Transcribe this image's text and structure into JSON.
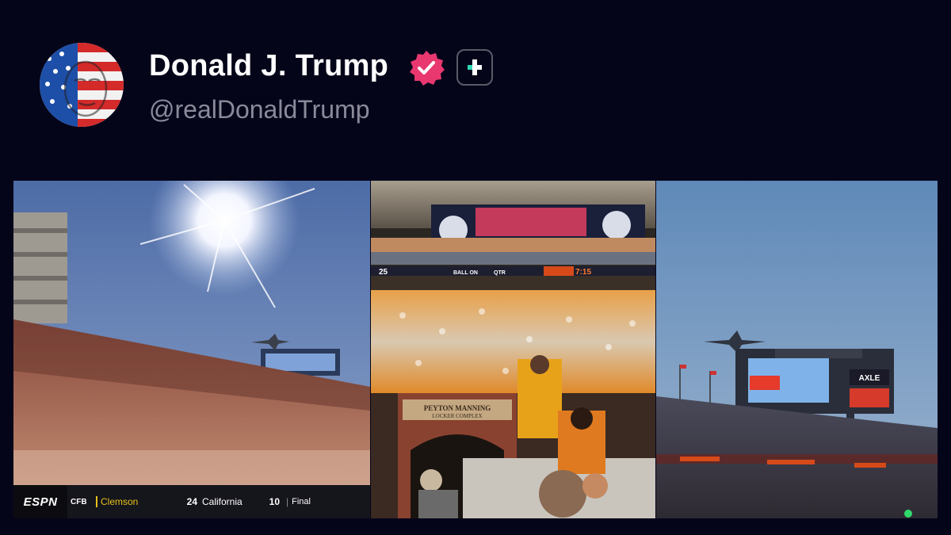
{
  "profile": {
    "display_name": "Donald J. Trump",
    "handle": "@realDonaldTrump",
    "verified_icon": "verified-badge-icon",
    "verified_color": "#e8386f",
    "follow_icon": "plus-icon",
    "accent": "#2fd8b4"
  },
  "media": {
    "scoreboard_ticker": {
      "network": "ESPN",
      "league": "CFB",
      "team1": "Clemson",
      "team1_score": "24",
      "team2": "California",
      "team2_score": "10",
      "separator": "|",
      "status": "Final"
    },
    "center_photo": {
      "scoreboard_ball_on": "BALL ON",
      "scoreboard_qtr": "QTR",
      "scoreboard_left_score": "25",
      "scoreboard_clock": "7:15",
      "gate_sign_line1": "PEYTON MANNING",
      "gate_sign_line2": "LOCKER COMPLEX"
    },
    "right_photo": {
      "sponsor": "AXLE"
    }
  }
}
